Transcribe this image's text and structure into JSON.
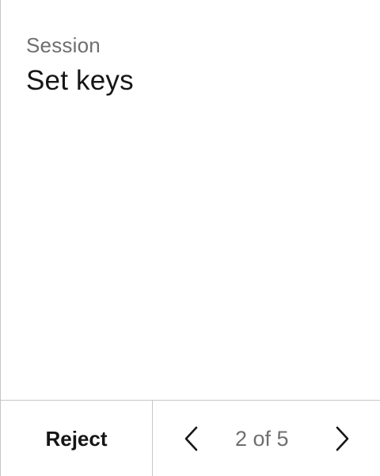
{
  "header": {
    "eyebrow": "Session",
    "title": "Set keys"
  },
  "footer": {
    "reject_label": "Reject",
    "pagination": {
      "current": 2,
      "total": 5,
      "label": "2 of 5",
      "prev_icon": "chevron-left-icon",
      "next_icon": "chevron-right-icon"
    }
  },
  "colors": {
    "background": "#ffffff",
    "border": "#c6c6c6",
    "text_primary": "#161616",
    "text_secondary": "#6f6f6f"
  }
}
